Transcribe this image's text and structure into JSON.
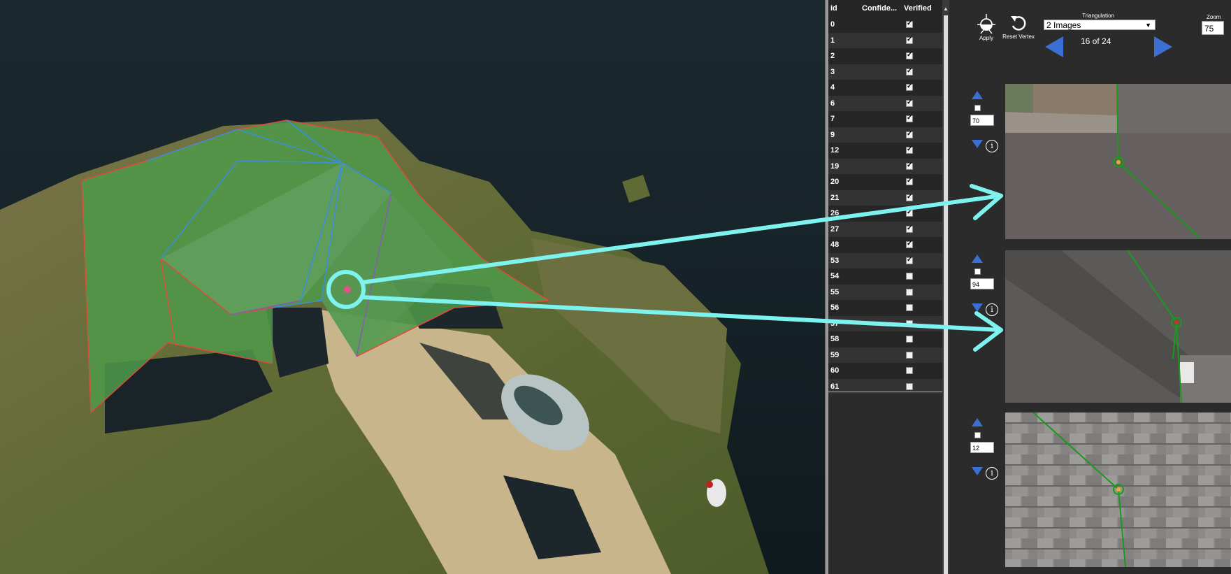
{
  "vertex_table": {
    "headers": {
      "id": "Id",
      "confidence": "Confide...",
      "verified": "Verified"
    },
    "rows": [
      {
        "id": "0",
        "verified": true
      },
      {
        "id": "1",
        "verified": true
      },
      {
        "id": "2",
        "verified": true
      },
      {
        "id": "3",
        "verified": true
      },
      {
        "id": "4",
        "verified": true
      },
      {
        "id": "6",
        "verified": true
      },
      {
        "id": "7",
        "verified": true
      },
      {
        "id": "9",
        "verified": true
      },
      {
        "id": "12",
        "verified": true
      },
      {
        "id": "19",
        "verified": true
      },
      {
        "id": "20",
        "verified": true
      },
      {
        "id": "21",
        "verified": true
      },
      {
        "id": "26",
        "verified": true
      },
      {
        "id": "27",
        "verified": true
      },
      {
        "id": "48",
        "verified": true
      },
      {
        "id": "53",
        "verified": true
      },
      {
        "id": "54",
        "verified": false
      },
      {
        "id": "55",
        "verified": false
      },
      {
        "id": "56",
        "verified": false
      },
      {
        "id": "57",
        "verified": false
      },
      {
        "id": "58",
        "verified": false
      },
      {
        "id": "59",
        "verified": false
      },
      {
        "id": "60",
        "verified": false
      },
      {
        "id": "61",
        "verified": false
      }
    ]
  },
  "toolbar": {
    "apply_label": "Apply",
    "reset_label": "Reset Vertex",
    "triangulation_label": "Triangulation",
    "triangulation_value": "2 Images",
    "page_count": "16 of 24",
    "zoom_label": "Zoom",
    "zoom_value": "75"
  },
  "images": [
    {
      "value": "70",
      "marker_color": "#e8b020"
    },
    {
      "value": "94",
      "marker_color": "#d03020"
    },
    {
      "value": "12",
      "marker_color": "#e8b020"
    }
  ],
  "colors": {
    "accent": "#3b6fd4",
    "annotation": "#7df2ee",
    "roof_fill": "#4f9a4a",
    "edge_red": "#e04a3a",
    "edge_blue": "#3a8ee0",
    "line_green": "#1a9a1a"
  },
  "icons": {
    "apply": "apply-vertex-icon",
    "reset": "reset-vertex-icon",
    "prev": "prev-arrow-icon",
    "next": "next-arrow-icon"
  }
}
